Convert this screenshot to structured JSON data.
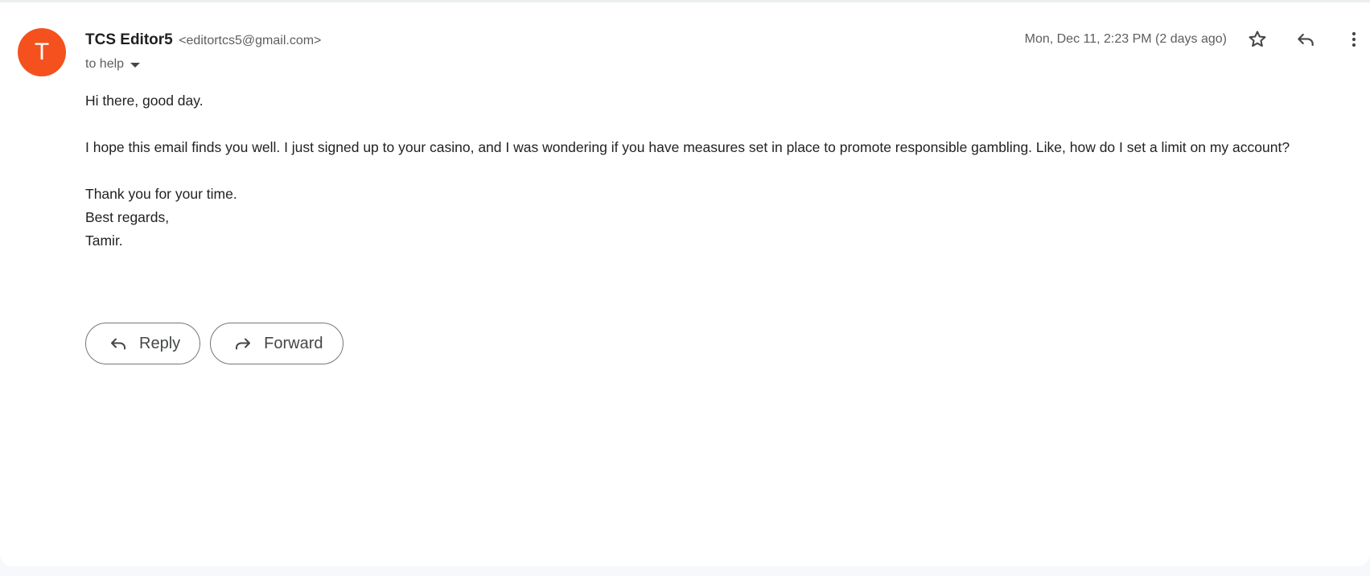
{
  "colors": {
    "avatar_bg": "#f4511e",
    "icon_color": "#444746"
  },
  "sender": {
    "avatar_initial": "T",
    "name": "TCS Editor5",
    "email": "<editortcs5@gmail.com>"
  },
  "recipient": {
    "label": "to help"
  },
  "meta": {
    "date": "Mon, Dec 11, 2:23 PM (2 days ago)",
    "star_icon": "star-outline-icon",
    "reply_icon": "reply-icon",
    "more_icon": "more-vert-icon"
  },
  "body": {
    "greeting": "Hi there, good day.",
    "paragraph": "I hope this email finds you well. I just signed up to your casino, and I was wondering if you have measures set in place to promote responsible gambling. Like, how do I set a limit on my account?",
    "closing_1": "Thank you for your time.",
    "closing_2": "Best regards,",
    "signature": "Tamir."
  },
  "actions": {
    "reply_label": "Reply",
    "forward_label": "Forward"
  }
}
